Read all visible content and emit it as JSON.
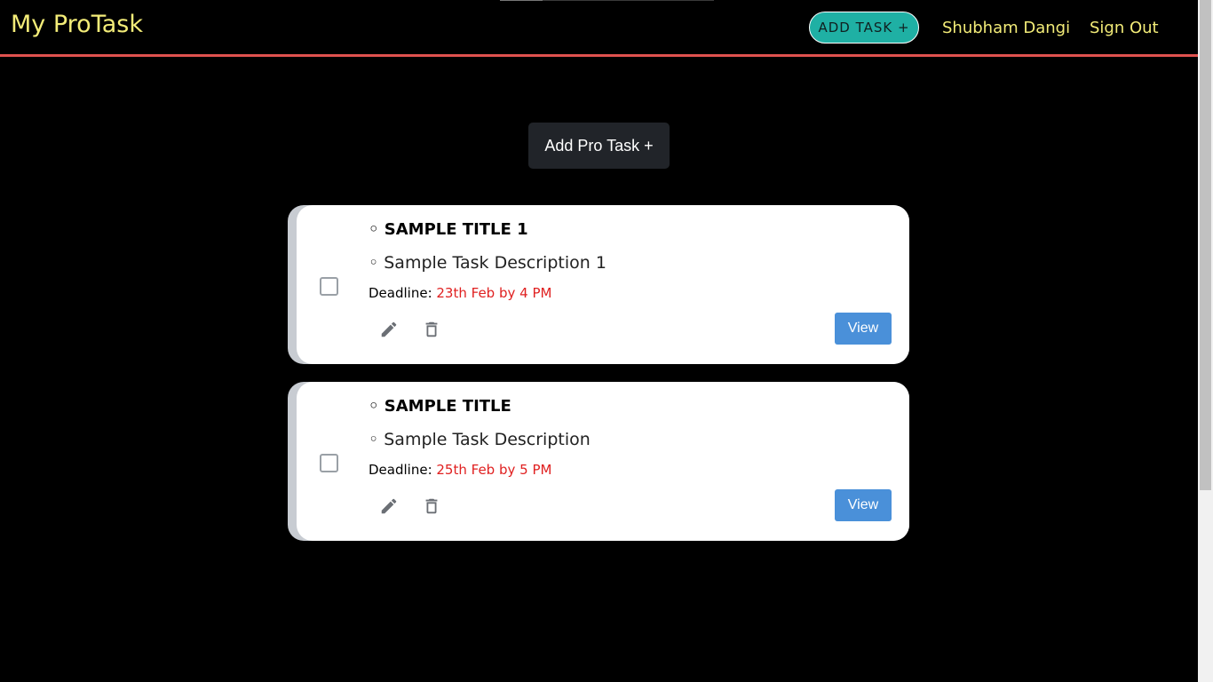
{
  "app": {
    "brand": "My ProTask"
  },
  "nav": {
    "add_task_label": "ADD TASK +",
    "user_name": "Shubham Dangi",
    "sign_out_label": "Sign Out"
  },
  "main": {
    "add_pro_task_label": "Add Pro Task +"
  },
  "tasks": [
    {
      "title": "◦ SAMPLE TITLE 1",
      "description": "◦ Sample Task Description 1",
      "deadline_label": "Deadline: ",
      "deadline_value": "23th Feb by 4 PM",
      "checked": false,
      "view_label": "View"
    },
    {
      "title": "◦ SAMPLE TITLE",
      "description": "◦ Sample Task Description",
      "deadline_label": "Deadline: ",
      "deadline_value": "25th Feb by 5 PM",
      "checked": false,
      "view_label": "View"
    }
  ],
  "colors": {
    "brand_yellow": "#f3ec78",
    "nav_border": "#e0524f",
    "add_task_teal": "#1fb0a4",
    "deadline_red": "#e02020",
    "view_blue": "#4a90d9",
    "icon_gray": "#6b6f75"
  },
  "icons": {
    "edit": "pencil-icon",
    "delete": "trash-icon"
  }
}
